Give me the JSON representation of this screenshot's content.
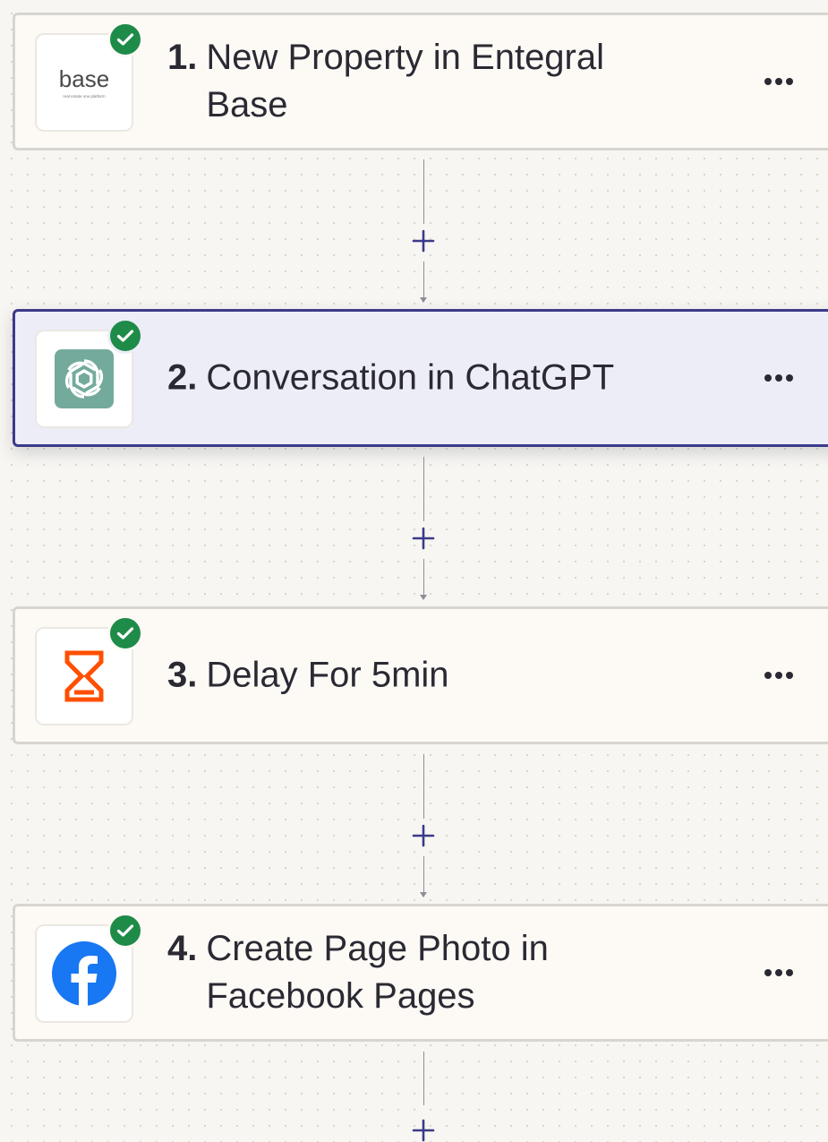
{
  "steps": [
    {
      "number": "1.",
      "title": "New Property in Entegral Base",
      "app": "Entegral Base",
      "icon": "entegral-base-logo",
      "status": "complete",
      "logo_text": "base",
      "logo_subtext": "real estate one platform"
    },
    {
      "number": "2.",
      "title": "Conversation in ChatGPT",
      "app": "ChatGPT",
      "icon": "chatgpt-logo",
      "status": "complete",
      "selected": true
    },
    {
      "number": "3.",
      "title": "Delay For 5min",
      "app": "Delay",
      "icon": "hourglass-icon",
      "status": "complete"
    },
    {
      "number": "4.",
      "title": "Create Page Photo in Facebook Pages",
      "app": "Facebook Pages",
      "icon": "facebook-logo",
      "status": "complete"
    }
  ],
  "colors": {
    "canvas": "#f7f6f2",
    "card": "#fdfaf6",
    "selected_card": "#ededf8",
    "selected_border": "#3b3a8a",
    "check": "#1e8b49",
    "connector_plus": "#3b3a8a",
    "chatgpt": "#74aa9c",
    "delay": "#ff4f00",
    "facebook": "#1877f2"
  },
  "add_step_icon": "plus-icon",
  "menu_icon": "more-horizontal-icon"
}
